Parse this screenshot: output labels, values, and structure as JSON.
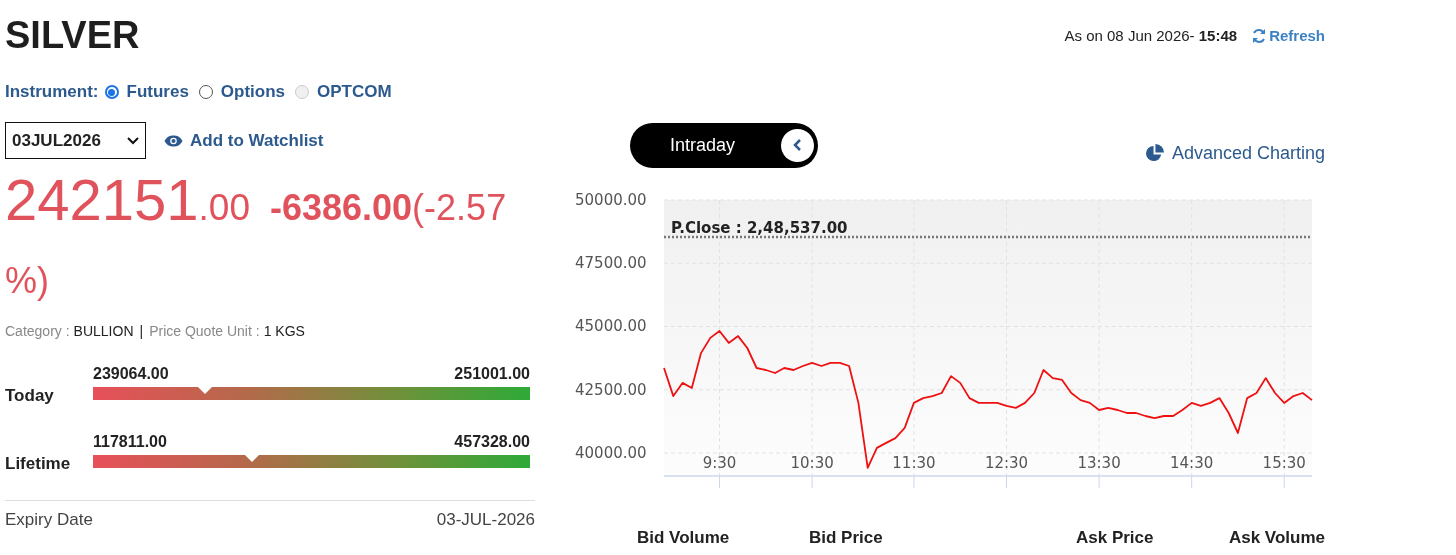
{
  "title": "SILVER",
  "as_on": {
    "label": "As on 08 Jun 2026-",
    "time": "15:48"
  },
  "refresh": {
    "label": "Refresh"
  },
  "instrument": {
    "label": "Instrument:",
    "options": [
      {
        "label": "Futures",
        "selected": true,
        "disabled": false
      },
      {
        "label": "Options",
        "selected": false,
        "disabled": false
      },
      {
        "label": "OPTCOM",
        "selected": false,
        "disabled": true
      }
    ]
  },
  "expiry_select": {
    "value": "03JUL2026"
  },
  "watchlist": {
    "label": "Add to Watchlist"
  },
  "price": {
    "whole": "242151",
    "decimals": ".00",
    "change": "-6386.00",
    "change_pct": "(-2.57 %)"
  },
  "meta": [
    {
      "label": "Category :",
      "value": "BULLION"
    },
    {
      "label": "Price Quote Unit :",
      "value": "1 KGS"
    }
  ],
  "meta_separator": "|",
  "ranges": [
    {
      "label": "Today",
      "low": "239064.00",
      "high": "251001.00",
      "level": 0.256
    },
    {
      "label": "Lifetime",
      "low": "117811.00",
      "high": "457328.00",
      "level": 0.364
    }
  ],
  "expiry": {
    "label": "Expiry Date",
    "value": "03-JUL-2026"
  },
  "chart_toggle": {
    "label": "Intraday"
  },
  "advanced_charting": {
    "label": "Advanced Charting"
  },
  "chart": {
    "chart_data": {
      "type": "line",
      "grid": true,
      "ylim": [
        39090,
        50000
      ],
      "yticks": [
        {
          "value": 50000,
          "label": "50000.00"
        },
        {
          "value": 47500,
          "label": "47500.00"
        },
        {
          "value": 45000,
          "label": "45000.00"
        },
        {
          "value": 42500,
          "label": "42500.00"
        },
        {
          "value": 40000,
          "label": "40000.00"
        }
      ],
      "categories": [
        null,
        null,
        null,
        null,
        null,
        null,
        "9:30",
        null,
        null,
        null,
        null,
        null,
        null,
        null,
        null,
        null,
        "10:30",
        null,
        null,
        null,
        null,
        null,
        null,
        null,
        null,
        null,
        null,
        "11:30",
        null,
        null,
        null,
        null,
        null,
        null,
        null,
        null,
        null,
        "12:30",
        null,
        null,
        null,
        null,
        null,
        null,
        null,
        null,
        null,
        "13:30",
        null,
        null,
        null,
        null,
        null,
        null,
        null,
        null,
        null,
        "14:30",
        null,
        null,
        null,
        null,
        null,
        null,
        null,
        null,
        null,
        "15:30",
        null,
        null,
        null
      ],
      "series": [
        {
          "color": "#ee1111",
          "line_style": "solid",
          "values": [
            43360,
            42250,
            42770,
            42570,
            43950,
            44550,
            44820,
            44350,
            44620,
            44150,
            43360,
            43280,
            43160,
            43360,
            43280,
            43440,
            43560,
            43440,
            43560,
            43560,
            43440,
            41980,
            39410,
            40200,
            40400,
            40590,
            40990,
            41980,
            42170,
            42250,
            42370,
            43040,
            42770,
            42170,
            41980,
            41980,
            41980,
            41860,
            41780,
            41980,
            42370,
            43280,
            42960,
            42890,
            42370,
            42090,
            41980,
            41700,
            41780,
            41700,
            41580,
            41580,
            41460,
            41380,
            41460,
            41460,
            41700,
            41980,
            41860,
            41980,
            42170,
            41580,
            40790,
            42170,
            42370,
            42960,
            42370,
            41980,
            42250,
            42370,
            42090
          ]
        },
        {
          "color": "#777777",
          "line_style": "dotted",
          "values": [
            48537,
            48537,
            48537,
            48537,
            48537,
            48537,
            48537,
            48537,
            48537,
            48537,
            48537,
            48537,
            48537,
            48537,
            48537,
            48537,
            48537,
            48537,
            48537,
            48537,
            48537,
            48537,
            48537,
            48537,
            48537,
            48537,
            48537,
            48537,
            48537,
            48537,
            48537,
            48537,
            48537,
            48537,
            48537,
            48537,
            48537,
            48537,
            48537,
            48537,
            48537,
            48537,
            48537,
            48537,
            48537,
            48537,
            48537,
            48537,
            48537,
            48537,
            48537,
            48537,
            48537,
            48537,
            48537,
            48537,
            48537,
            48537,
            48537,
            48537,
            48537,
            48537,
            48537,
            48537,
            48537,
            48537,
            48537,
            48537,
            48537,
            48537,
            48537
          ]
        }
      ],
      "annotations": [
        "P.Close : 2,48,537.00"
      ]
    }
  },
  "depth_columns": [
    "Bid Volume",
    "Bid Price",
    "Ask Price",
    "Ask Volume"
  ]
}
